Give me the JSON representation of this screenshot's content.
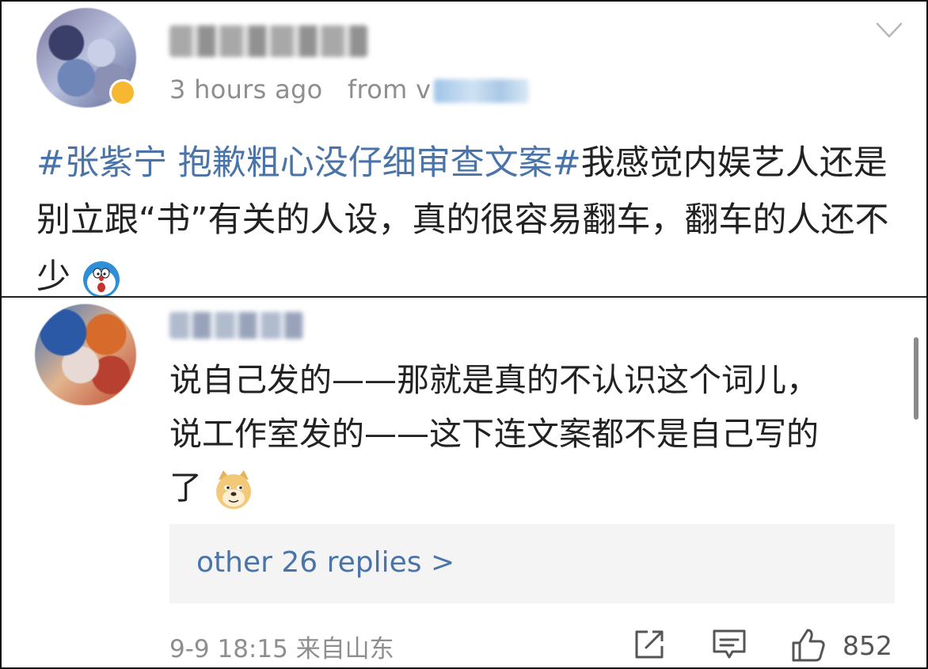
{
  "post": {
    "author_name": "",
    "time": "3 hours ago",
    "from_label": "from",
    "from_source_partial": "v",
    "hashtag": "#张紫宁 抱歉粗心没仔细审查文案#",
    "text": "我感觉内娱艺人还是别立跟“书”有关的人设，真的很容易翻车，翻车的人还不少",
    "emoji": "doraemon-emoji",
    "menu_icon": "chevron-down-icon"
  },
  "comment": {
    "author_name": "",
    "text_line1": "说自己发的——那就是真的不认识这个词儿，",
    "text_line2": "说工作室发的——这下连文案都不是自己写的",
    "text_line3": "了",
    "emoji": "doge-emoji",
    "replies_label": "other 26 replies >",
    "date": "9-9 18:15",
    "location": "来自山东",
    "like_count": "852",
    "icons": [
      "share-icon",
      "reply-icon",
      "like-icon"
    ]
  },
  "colors": {
    "link": "#4a74a8",
    "meta": "#8e8e8e",
    "text": "#222222",
    "reply_bg": "#f4f4f4",
    "badge": "#f6b731"
  }
}
